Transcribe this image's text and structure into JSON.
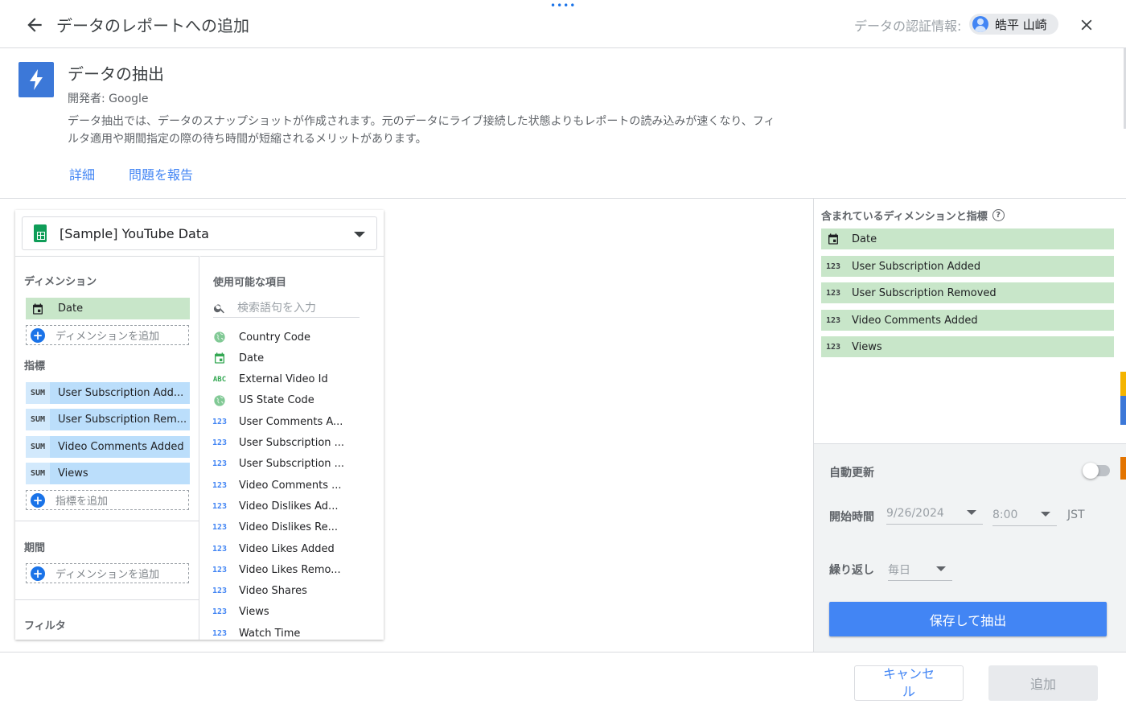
{
  "header": {
    "title": "データのレポートへの追加",
    "credentials_label": "データの認証情報:",
    "user_name": "皓平 山崎",
    "drag_handle": "••••"
  },
  "connector": {
    "name": "データの抽出",
    "developer": "開発者: Google",
    "description": "データ抽出では、データのスナップショットが作成されます。元のデータにライブ接続した状態よりもレポートの読み込みが速くなり、フィルタ適用や期間指定の際の待ち時間が短縮されるメリットがあります。",
    "link_details": "詳細",
    "link_report": "問題を報告"
  },
  "editor": {
    "source": "[Sample] YouTube Data",
    "dimensions_label": "ディメンション",
    "dimensions": [
      {
        "label": "Date",
        "icon": "calendar-icon"
      }
    ],
    "add_dimension": "ディメンションを追加",
    "metrics_label": "指標",
    "metrics": [
      {
        "agg": "SUM",
        "label": "User Subscription Add..."
      },
      {
        "agg": "SUM",
        "label": "User Subscription Rem..."
      },
      {
        "agg": "SUM",
        "label": "Video Comments Added"
      },
      {
        "agg": "SUM",
        "label": "Views"
      }
    ],
    "add_metric": "指標を追加",
    "period_label": "期間",
    "add_period_dimension": "ディメンションを追加",
    "filter_label": "フィルタ",
    "available_label": "使用可能な項目",
    "search_placeholder": "検索語句を入力",
    "available_fields": [
      {
        "icon": "globe-icon",
        "type": "geo",
        "label": "Country Code"
      },
      {
        "icon": "calendar-icon",
        "type": "date",
        "label": "Date"
      },
      {
        "icon": "abc-icon",
        "type": "text",
        "label": "External Video Id"
      },
      {
        "icon": "globe-icon",
        "type": "geo",
        "label": "US State Code"
      },
      {
        "icon": "number-icon",
        "type": "num",
        "label": "User Comments A..."
      },
      {
        "icon": "number-icon",
        "type": "num",
        "label": "User Subscription ..."
      },
      {
        "icon": "number-icon",
        "type": "num",
        "label": "User Subscription ..."
      },
      {
        "icon": "number-icon",
        "type": "num",
        "label": "Video Comments ..."
      },
      {
        "icon": "number-icon",
        "type": "num",
        "label": "Video Dislikes Ad..."
      },
      {
        "icon": "number-icon",
        "type": "num",
        "label": "Video Dislikes Re..."
      },
      {
        "icon": "number-icon",
        "type": "num",
        "label": "Video Likes Added"
      },
      {
        "icon": "number-icon",
        "type": "num",
        "label": "Video Likes Remo..."
      },
      {
        "icon": "number-icon",
        "type": "num",
        "label": "Video Shares"
      },
      {
        "icon": "number-icon",
        "type": "num",
        "label": "Views"
      },
      {
        "icon": "number-icon",
        "type": "num",
        "label": "Watch Time"
      }
    ],
    "number_glyph": "123",
    "text_glyph": "ABC"
  },
  "included": {
    "label": "含まれているディメンションと指標",
    "help_glyph": "?",
    "items": [
      {
        "icon": "calendar-icon",
        "label": "Date"
      },
      {
        "icon": "number-icon",
        "label": "User Subscription Added"
      },
      {
        "icon": "number-icon",
        "label": "User Subscription Removed"
      },
      {
        "icon": "number-icon",
        "label": "Video Comments Added"
      },
      {
        "icon": "number-icon",
        "label": "Views"
      }
    ]
  },
  "schedule": {
    "auto_update_label": "自動更新",
    "auto_update_on": false,
    "start_time_label": "開始時間",
    "start_date": "9/26/2024",
    "start_hour": "8:00",
    "timezone": "JST",
    "repeat_label": "繰り返し",
    "repeat_value": "毎日",
    "save_button": "保存して抽出"
  },
  "footer": {
    "cancel": "キャンセル",
    "add": "追加"
  },
  "colors": {
    "accent": "#4285f4",
    "dimension_chip": "#c8e6c9",
    "metric_chip": "#bbdefb",
    "connector_logo": "#3c78d8",
    "sheets_green": "#0f9d58"
  }
}
